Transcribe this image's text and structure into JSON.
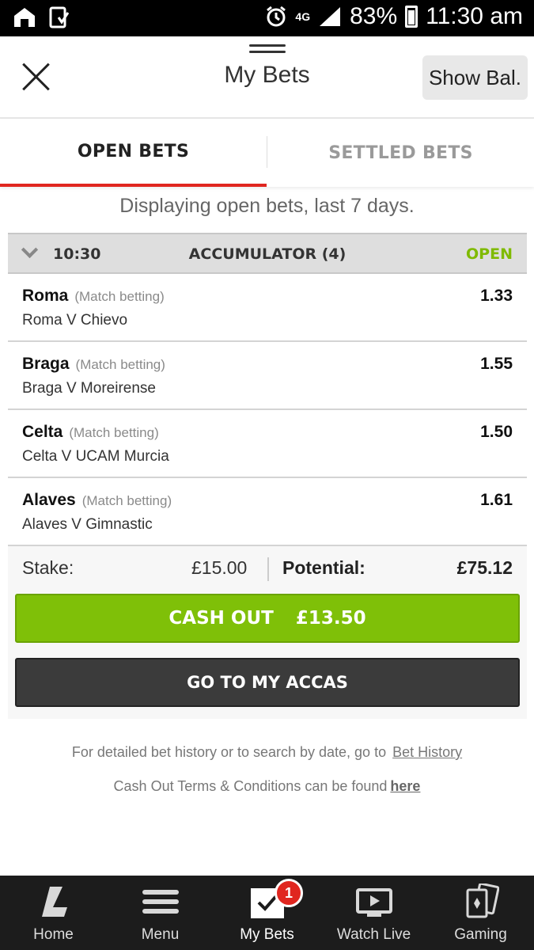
{
  "status_bar": {
    "network": "4G",
    "battery": "83%",
    "time": "11:30 am"
  },
  "header": {
    "title": "My Bets",
    "show_balance_label": "Show Bal."
  },
  "tabs": [
    {
      "label": "OPEN BETS",
      "active": true
    },
    {
      "label": "SETTLED BETS",
      "active": false
    }
  ],
  "info_text": "Displaying open bets, last 7 days.",
  "bet": {
    "time": "10:30",
    "type": "ACCUMULATOR (4)",
    "status": "OPEN",
    "selections": [
      {
        "name": "Roma",
        "market": "(Match betting)",
        "event": "Roma V Chievo",
        "odds": "1.33"
      },
      {
        "name": "Braga",
        "market": "(Match betting)",
        "event": "Braga V Moreirense",
        "odds": "1.55"
      },
      {
        "name": "Celta",
        "market": "(Match betting)",
        "event": "Celta V UCAM Murcia",
        "odds": "1.50"
      },
      {
        "name": "Alaves",
        "market": "(Match betting)",
        "event": "Alaves V Gimnastic",
        "odds": "1.61"
      }
    ],
    "stake_label": "Stake:",
    "stake_value": "£15.00",
    "potential_label": "Potential:",
    "potential_value": "£75.12",
    "cashout_label": "CASH OUT",
    "cashout_value": "£13.50",
    "accas_label": "GO TO MY ACCAS"
  },
  "footer": {
    "history_text": "For detailed bet history or to search by date, go to",
    "history_link": "Bet History",
    "terms_text": "Cash Out Terms & Conditions can be found",
    "terms_link": "here"
  },
  "bottom_nav": [
    {
      "label": "Home",
      "icon": "home-logo-icon"
    },
    {
      "label": "Menu",
      "icon": "menu-icon"
    },
    {
      "label": "My Bets",
      "icon": "my-bets-icon",
      "badge": "1",
      "active": true
    },
    {
      "label": "Watch Live",
      "icon": "watch-live-icon"
    },
    {
      "label": "Gaming",
      "icon": "gaming-cards-icon"
    }
  ],
  "colors": {
    "accent_red": "#e0261f",
    "open_green": "#7fba00",
    "cashout_green": "#7fc008",
    "accas_dark": "#3b3b3b",
    "nav_bg": "#1c1c1c"
  }
}
